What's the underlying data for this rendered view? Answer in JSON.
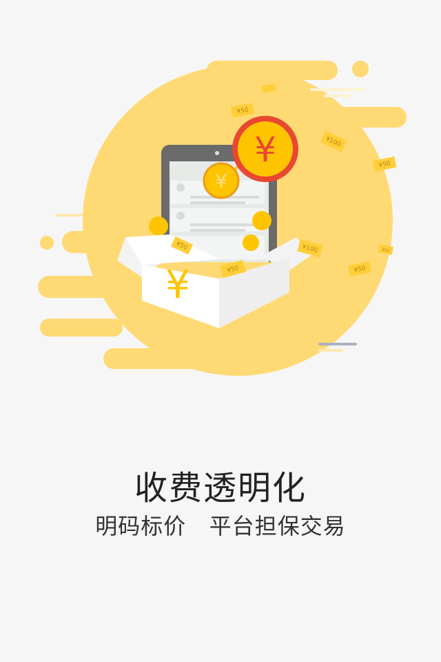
{
  "onboarding": {
    "title": "收费透明化",
    "subtitle": "明码标价   平台担保交易"
  },
  "illustration": {
    "big_coin_label": "¥",
    "small_coin_label": "¥",
    "box_label": "¥",
    "notes": [
      "¥50",
      "¥100",
      "¥50",
      "¥50",
      "¥100",
      "¥50",
      "¥50",
      "¥50"
    ]
  },
  "colors": {
    "background": "#f6f6f6",
    "yellow": "#ffd974",
    "coin": "#ffc400",
    "big_coin_red": "#e84732"
  }
}
